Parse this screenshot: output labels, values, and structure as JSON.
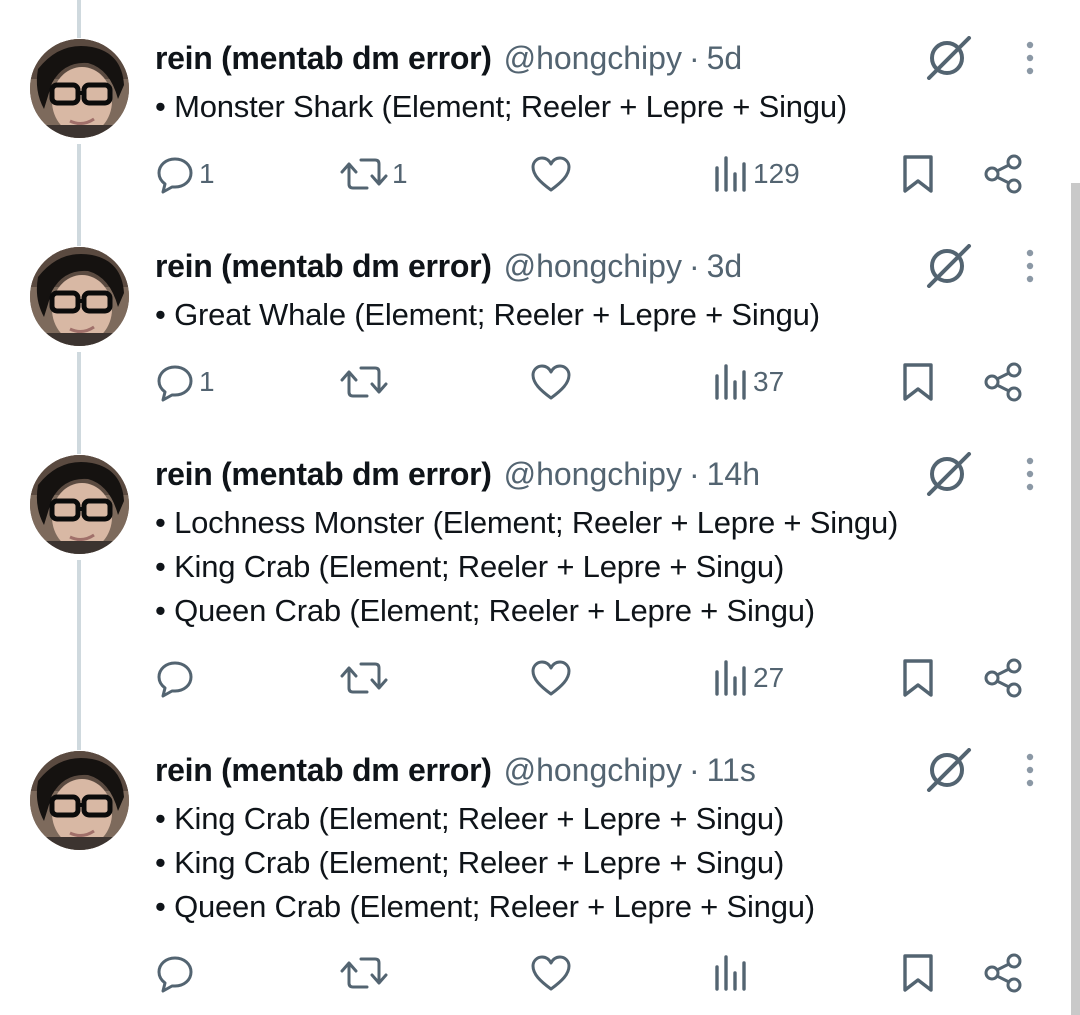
{
  "tweets": [
    {
      "author_name": "rein (mentab dm error)",
      "handle": "@hongchipy",
      "separator": "·",
      "time": "5d",
      "lines": [
        "• Monster Shark (Element; Reeler + Lepre + Singu)"
      ],
      "reply_count": "1",
      "retweet_count": "1",
      "like_count": "",
      "view_count": "129"
    },
    {
      "author_name": "rein (mentab dm error)",
      "handle": "@hongchipy",
      "separator": "·",
      "time": "3d",
      "lines": [
        "• Great Whale (Element; Reeler + Lepre + Singu)"
      ],
      "reply_count": "1",
      "retweet_count": "",
      "like_count": "",
      "view_count": "37"
    },
    {
      "author_name": "rein (mentab dm error)",
      "handle": "@hongchipy",
      "separator": "·",
      "time": "14h",
      "lines": [
        "• Lochness Monster (Element; Reeler + Lepre + Singu)",
        "• King Crab (Element; Reeler + Lepre + Singu)",
        "• Queen Crab (Element; Reeler + Lepre + Singu)"
      ],
      "reply_count": "",
      "retweet_count": "",
      "like_count": "",
      "view_count": "27"
    },
    {
      "author_name": "rein (mentab dm error)",
      "handle": "@hongchipy",
      "separator": "·",
      "time": "11s",
      "lines": [
        "• King Crab (Element; Releer + Lepre + Singu)",
        "• King Crab (Element; Releer + Lepre + Singu)",
        "• Queen Crab (Element; Releer + Lepre + Singu)"
      ],
      "reply_count": "",
      "retweet_count": "",
      "like_count": "",
      "view_count": ""
    }
  ],
  "icons": {
    "avatar": "avatar",
    "grok": "grok-icon",
    "more": "more-icon",
    "reply": "reply-icon",
    "retweet": "retweet-icon",
    "like": "like-icon",
    "views": "views-icon",
    "bookmark": "bookmark-icon",
    "share": "share-icon"
  },
  "colors": {
    "text": "#0f1419",
    "secondary": "#536471",
    "thread_line": "#cfd9de",
    "background": "#ffffff"
  }
}
